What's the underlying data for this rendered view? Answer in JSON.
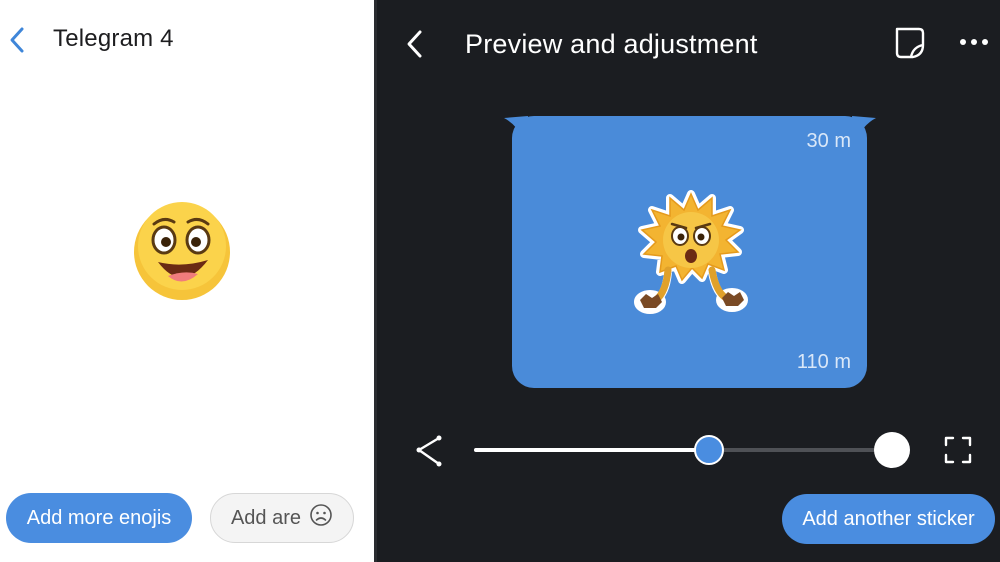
{
  "left_panel": {
    "title": "Telegram 4",
    "emoji_name": "grinning-face-emoji",
    "buttons": {
      "add_more_label": "Add more enojis",
      "add_are_label": "Add are"
    }
  },
  "right_panel": {
    "title": "Preview and adjustment",
    "bubble": {
      "top_time": "30 m",
      "bottom_time": "110 m"
    },
    "slider": {
      "value_fraction": 0.56
    },
    "add_sticker_label": "Add another sticker"
  },
  "colors": {
    "accent": "#4a8de0",
    "bubble": "#4a8bd9",
    "dark_bg": "#1b1d21"
  }
}
